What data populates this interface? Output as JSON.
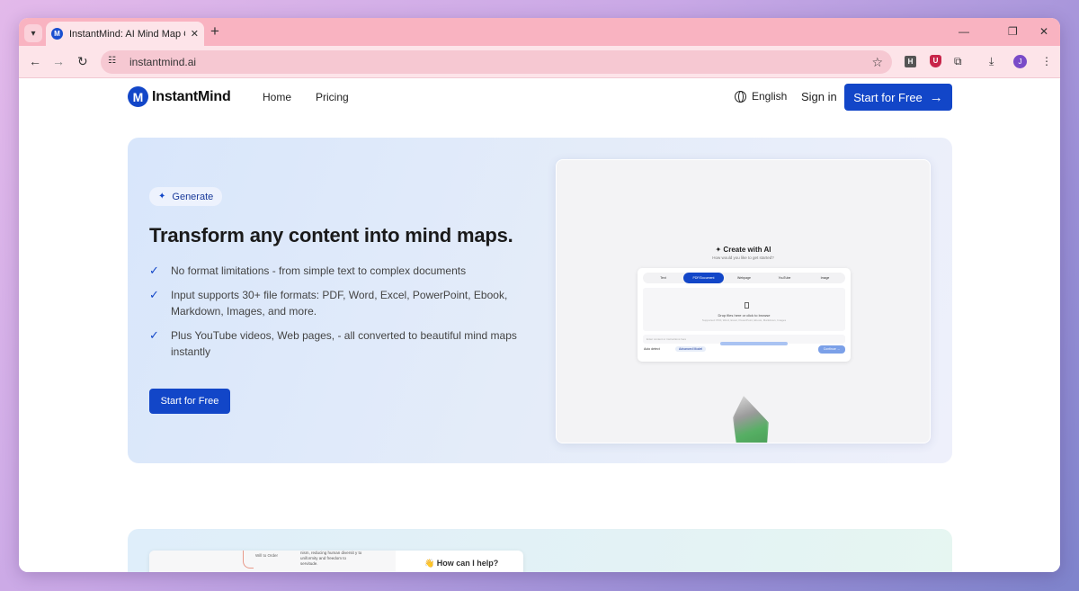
{
  "browser": {
    "tab_title": "InstantMind: AI Mind Map Generator",
    "tab_favicon_letter": "M",
    "new_tab_label": "+",
    "url": "instantmind.ai",
    "ext_h_label": "H",
    "ext_shield_label": "U",
    "profile_initial": "J",
    "icons": {
      "tab_search": "chevron-down-icon",
      "close": "close-icon",
      "back": "arrow-left-icon",
      "forward": "arrow-right-icon",
      "reload": "reload-icon",
      "site_info": "tune-icon",
      "bookmark": "star-icon",
      "extensions": "puzzle-icon",
      "downloads": "download-icon",
      "menu": "kebab-menu-icon",
      "minimize": "minimize-icon",
      "restore": "restore-icon"
    }
  },
  "nav": {
    "logo_letter": "M",
    "logo_text": "InstantMind",
    "links": [
      "Home",
      "Pricing"
    ],
    "language": "English",
    "sign_in": "Sign in",
    "cta": "Start for Free",
    "cta_arrow": "→"
  },
  "hero": {
    "badge": "Generate",
    "badge_icon": "✦",
    "title": "Transform any content into mind maps.",
    "features": [
      "No format limitations - from simple text to complex documents",
      "Input supports 30+ file formats: PDF, Word, Excel, PowerPoint, Ebook, Markdown, Images, and more.",
      "Plus YouTube videos, Web pages, - all converted to beautiful mind maps instantly"
    ],
    "check_icon": "✓",
    "cta": "Start for Free"
  },
  "preview": {
    "title": "✦ Create with AI",
    "subtitle": "How would you like to get started?",
    "tabs": [
      "Text",
      "PDF/Document",
      "Webpage",
      "YouTube",
      "Image"
    ],
    "active_tab": "PDF/Document",
    "drop_text": "Drop files here or click to browse",
    "drop_subtext": "Supported: PDF, Word, Excel, PowerPoint, Ebook, Markdown, Images",
    "input_placeholder": "Enter content or instructions here",
    "auto_detect": "Auto detect",
    "advanced_model": "Advanced Model",
    "generate": "Continue →"
  },
  "section2": {
    "node_label": "Will to Order",
    "node_text": "nism, reducing human diversit y to uniformity and freedom to servitude.",
    "help_text": "👋 How can I help?"
  },
  "colors": {
    "brand": "#1246c8",
    "tab_strip": "#f9b3c1",
    "toolbar": "#fde4e9"
  }
}
